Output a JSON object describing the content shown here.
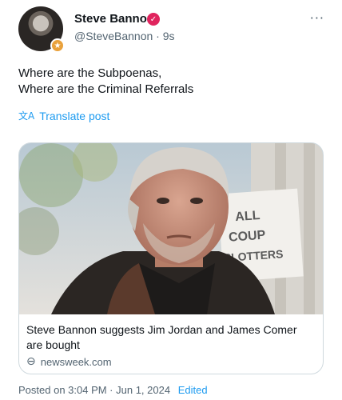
{
  "author": {
    "name": "Steve Bannon",
    "handle": "@SteveBannon",
    "time": "9s",
    "separator": "·"
  },
  "icons": {
    "verified": "verified-badge-icon",
    "more": "more-options-icon",
    "translate": "translate-icon",
    "link": "link-icon",
    "avatar_badge": "affiliate-badge-icon"
  },
  "post": {
    "text": "Where are the Subpoenas,\nWhere are the Criminal Referrals",
    "translate_label": "Translate post"
  },
  "card": {
    "headline": "Steve Bannon suggests Jim Jordan and James Comer are bought",
    "domain": "newsweek.com",
    "sign_text": "ALL COUP PLOTTERS"
  },
  "footer": {
    "posted": "Posted on 3:04 PM · Jun 1, 2024",
    "edited_label": "Edited"
  },
  "colors": {
    "accent": "#1d9bf0",
    "verified": "#e0245e",
    "muted": "#536471",
    "border": "#cfd9de"
  }
}
